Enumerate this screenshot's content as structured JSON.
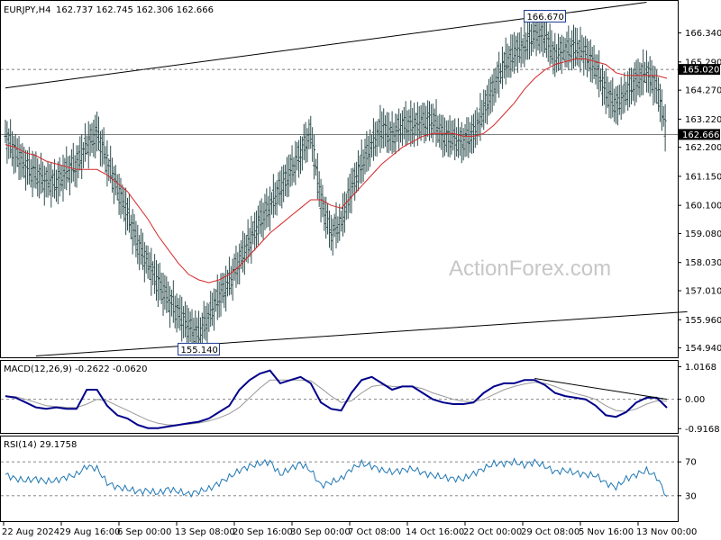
{
  "header": {
    "symbol": "EURJPY,H4",
    "ohlc": "162.737 162.745 162.306 162.666"
  },
  "watermark": "ActionForex.com",
  "colors": {
    "bar": "#2f4f4f",
    "ma": "#d62728",
    "macd": "#00008b",
    "signal": "#999999",
    "rsi": "#1f77b4",
    "trendline": "#000000",
    "current_price_bg": "#000000"
  },
  "chart_data": [
    {
      "type": "line",
      "title": "",
      "subtitle": "EURJPY,H4 162.737 162.745 162.306 162.666",
      "ylim": [
        154.6,
        167.5
      ],
      "y_ticks": [
        "166.340",
        "165.290",
        "164.270",
        "163.220",
        "162.200",
        "161.150",
        "160.100",
        "159.080",
        "158.030",
        "157.010",
        "155.960",
        "154.940"
      ],
      "x_ticks": [
        "22 Aug 2024",
        "29 Aug 16:00",
        "6 Sep 00:00",
        "13 Sep 08:00",
        "20 Sep 16:00",
        "30 Sep 00:00",
        "7 Oct 08:00",
        "14 Oct 16:00",
        "22 Oct 00:00",
        "29 Oct 08:00",
        "5 Nov 16:00",
        "13 Nov 00:00"
      ],
      "series": [
        {
          "kind": "price_closes",
          "values": [
            162.6,
            162.0,
            161.5,
            161.2,
            161.0,
            160.9,
            161.3,
            161.6,
            162.3,
            162.7,
            161.7,
            160.7,
            159.8,
            158.7,
            158.0,
            157.3,
            156.7,
            156.2,
            155.7,
            155.4,
            156.1,
            156.8,
            157.3,
            158.1,
            158.8,
            159.5,
            160.1,
            160.7,
            161.3,
            162.0,
            162.7,
            160.3,
            159.1,
            159.5,
            160.7,
            161.6,
            162.3,
            162.9,
            162.6,
            163.0,
            163.0,
            163.1,
            163.2,
            162.6,
            162.5,
            162.4,
            162.7,
            163.5,
            164.4,
            165.2,
            165.6,
            165.9,
            166.3,
            166.2,
            165.5,
            165.7,
            165.8,
            165.6,
            165.1,
            164.2,
            163.7,
            164.2,
            164.6,
            164.9,
            164.4,
            162.666
          ]
        },
        {
          "kind": "moving_average",
          "values": [
            162.3,
            162.2,
            162.0,
            161.9,
            161.7,
            161.6,
            161.5,
            161.4,
            161.4,
            161.4,
            161.2,
            160.9,
            160.6,
            160.1,
            159.6,
            159.0,
            158.5,
            158.0,
            157.6,
            157.4,
            157.3,
            157.4,
            157.6,
            157.9,
            158.3,
            158.7,
            159.1,
            159.4,
            159.7,
            160.0,
            160.3,
            160.3,
            160.1,
            160.0,
            160.4,
            160.8,
            161.2,
            161.6,
            161.9,
            162.2,
            162.4,
            162.6,
            162.7,
            162.7,
            162.7,
            162.6,
            162.6,
            162.7,
            163.0,
            163.4,
            163.8,
            164.3,
            164.7,
            165.0,
            165.2,
            165.3,
            165.4,
            165.4,
            165.3,
            165.2,
            164.9,
            164.8,
            164.8,
            164.8,
            164.8,
            164.7
          ]
        }
      ],
      "annotations": [
        {
          "label": "166.670",
          "x_index": 53,
          "value": 166.67
        },
        {
          "label": "155.140",
          "x_index": 19,
          "value": 155.14
        }
      ],
      "horizontal_lines": [
        {
          "label": "165.020",
          "value": 165.02,
          "style": "dashed"
        },
        {
          "label": "162.666",
          "value": 162.666,
          "style": "solid"
        }
      ],
      "trendlines": [
        {
          "name": "upper",
          "from": [
            0,
            164.35
          ],
          "to": [
            63,
            167.45
          ]
        },
        {
          "name": "lower",
          "from": [
            3,
            154.65
          ],
          "to": [
            67,
            156.25
          ]
        }
      ]
    },
    {
      "type": "line",
      "title": "MACD(12,26,9) -0.2622 -0.0620",
      "ylim": [
        -1.05,
        1.2
      ],
      "y_ticks": [
        "1.0168",
        "0.00",
        "-0.9168"
      ],
      "series": [
        {
          "name": "MACD",
          "values": [
            0.1,
            0.05,
            -0.1,
            -0.25,
            -0.3,
            -0.25,
            -0.3,
            -0.3,
            0.3,
            0.3,
            -0.2,
            -0.5,
            -0.6,
            -0.8,
            -0.9,
            -0.9,
            -0.85,
            -0.8,
            -0.75,
            -0.7,
            -0.6,
            -0.4,
            -0.2,
            0.3,
            0.6,
            0.8,
            0.9,
            0.5,
            0.6,
            0.7,
            0.5,
            -0.1,
            -0.3,
            -0.35,
            0.2,
            0.6,
            0.7,
            0.5,
            0.3,
            0.4,
            0.4,
            0.2,
            0.0,
            -0.1,
            -0.15,
            -0.15,
            -0.1,
            0.2,
            0.4,
            0.5,
            0.5,
            0.6,
            0.6,
            0.45,
            0.2,
            0.1,
            0.05,
            0.0,
            -0.2,
            -0.5,
            -0.55,
            -0.4,
            -0.1,
            0.05,
            0.05,
            -0.262
          ]
        },
        {
          "name": "Signal",
          "values": [
            0.1,
            0.08,
            0.0,
            -0.1,
            -0.2,
            -0.23,
            -0.25,
            -0.26,
            -0.15,
            0.0,
            -0.05,
            -0.2,
            -0.35,
            -0.5,
            -0.65,
            -0.75,
            -0.8,
            -0.8,
            -0.78,
            -0.74,
            -0.68,
            -0.58,
            -0.45,
            -0.25,
            0.05,
            0.35,
            0.6,
            0.6,
            0.6,
            0.6,
            0.58,
            0.35,
            0.1,
            -0.1,
            -0.05,
            0.2,
            0.4,
            0.45,
            0.4,
            0.4,
            0.4,
            0.33,
            0.2,
            0.1,
            0.0,
            -0.06,
            -0.08,
            0.0,
            0.15,
            0.3,
            0.4,
            0.48,
            0.53,
            0.5,
            0.4,
            0.28,
            0.18,
            0.1,
            0.0,
            -0.2,
            -0.35,
            -0.38,
            -0.3,
            -0.15,
            -0.05,
            -0.062
          ]
        }
      ],
      "trendlines": [
        {
          "name": "macd-resistance",
          "from": [
            52,
            0.65
          ],
          "to": [
            65,
            0.0
          ]
        }
      ]
    },
    {
      "type": "line",
      "title": "RSI(14) 29.1758",
      "ylim": [
        0,
        100
      ],
      "y_ticks": [
        "70",
        "30"
      ],
      "reference_levels": [
        70,
        30
      ],
      "series": [
        {
          "name": "RSI",
          "values": [
            55,
            50,
            48,
            50,
            47,
            48,
            52,
            55,
            65,
            62,
            45,
            40,
            38,
            35,
            36,
            33,
            38,
            35,
            32,
            35,
            38,
            45,
            52,
            60,
            65,
            68,
            70,
            55,
            62,
            68,
            60,
            42,
            46,
            50,
            62,
            68,
            65,
            60,
            58,
            60,
            62,
            57,
            54,
            52,
            50,
            50,
            56,
            62,
            68,
            68,
            70,
            66,
            70,
            65,
            58,
            60,
            57,
            55,
            54,
            45,
            40,
            50,
            55,
            60,
            52,
            29.18
          ]
        }
      ]
    }
  ]
}
